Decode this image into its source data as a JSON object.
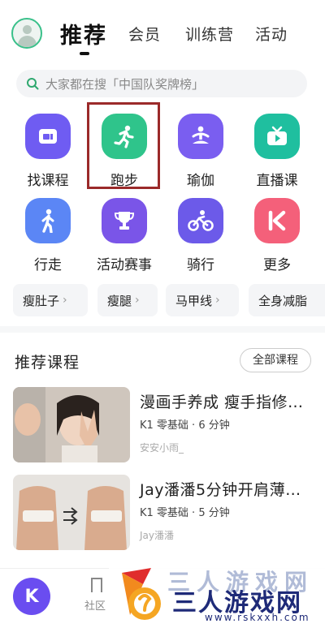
{
  "nav": {
    "tabs": [
      {
        "label": "推荐",
        "active": true
      },
      {
        "label": "会员",
        "active": false
      },
      {
        "label": "训练营",
        "active": false
      },
      {
        "label": "活动",
        "active": false
      }
    ]
  },
  "search": {
    "placeholder": "大家都在搜「中国队奖牌榜」"
  },
  "categories": [
    {
      "label": "找课程",
      "icon": "course-search-icon",
      "color": "#6f5cf2"
    },
    {
      "label": "跑步",
      "icon": "running-icon",
      "color": "#2fc48b",
      "highlighted": true
    },
    {
      "label": "瑜伽",
      "icon": "yoga-icon",
      "color": "#7a5ef0"
    },
    {
      "label": "直播课",
      "icon": "live-tv-icon",
      "color": "#1fbf9f"
    },
    {
      "label": "行走",
      "icon": "walking-icon",
      "color": "#5b86f5"
    },
    {
      "label": "活动赛事",
      "icon": "trophy-icon",
      "color": "#7a55e8"
    },
    {
      "label": "骑行",
      "icon": "cycling-icon",
      "color": "#6c5ae9"
    },
    {
      "label": "更多",
      "icon": "keep-k-icon",
      "color": "#f4607a"
    }
  ],
  "chips": [
    "瘦肚子",
    "瘦腿",
    "马甲线",
    "全身减脂"
  ],
  "section": {
    "title": "推荐课程",
    "all_label": "全部课程"
  },
  "courses": [
    {
      "title": "漫画手养成 瘦手指修…",
      "meta": "K1 零基础 · 6 分钟",
      "author": "安安小雨_"
    },
    {
      "title": "Jay潘潘5分钟开肩薄…",
      "meta": "K1 零基础 · 5 分钟",
      "author": "Jay潘潘"
    }
  ],
  "bottom": {
    "community_label": "社区",
    "fab_label": "K"
  },
  "watermark": {
    "name": "三人游戏网",
    "url": "www.rskxxh.com",
    "blurred": "三人游戏网"
  }
}
